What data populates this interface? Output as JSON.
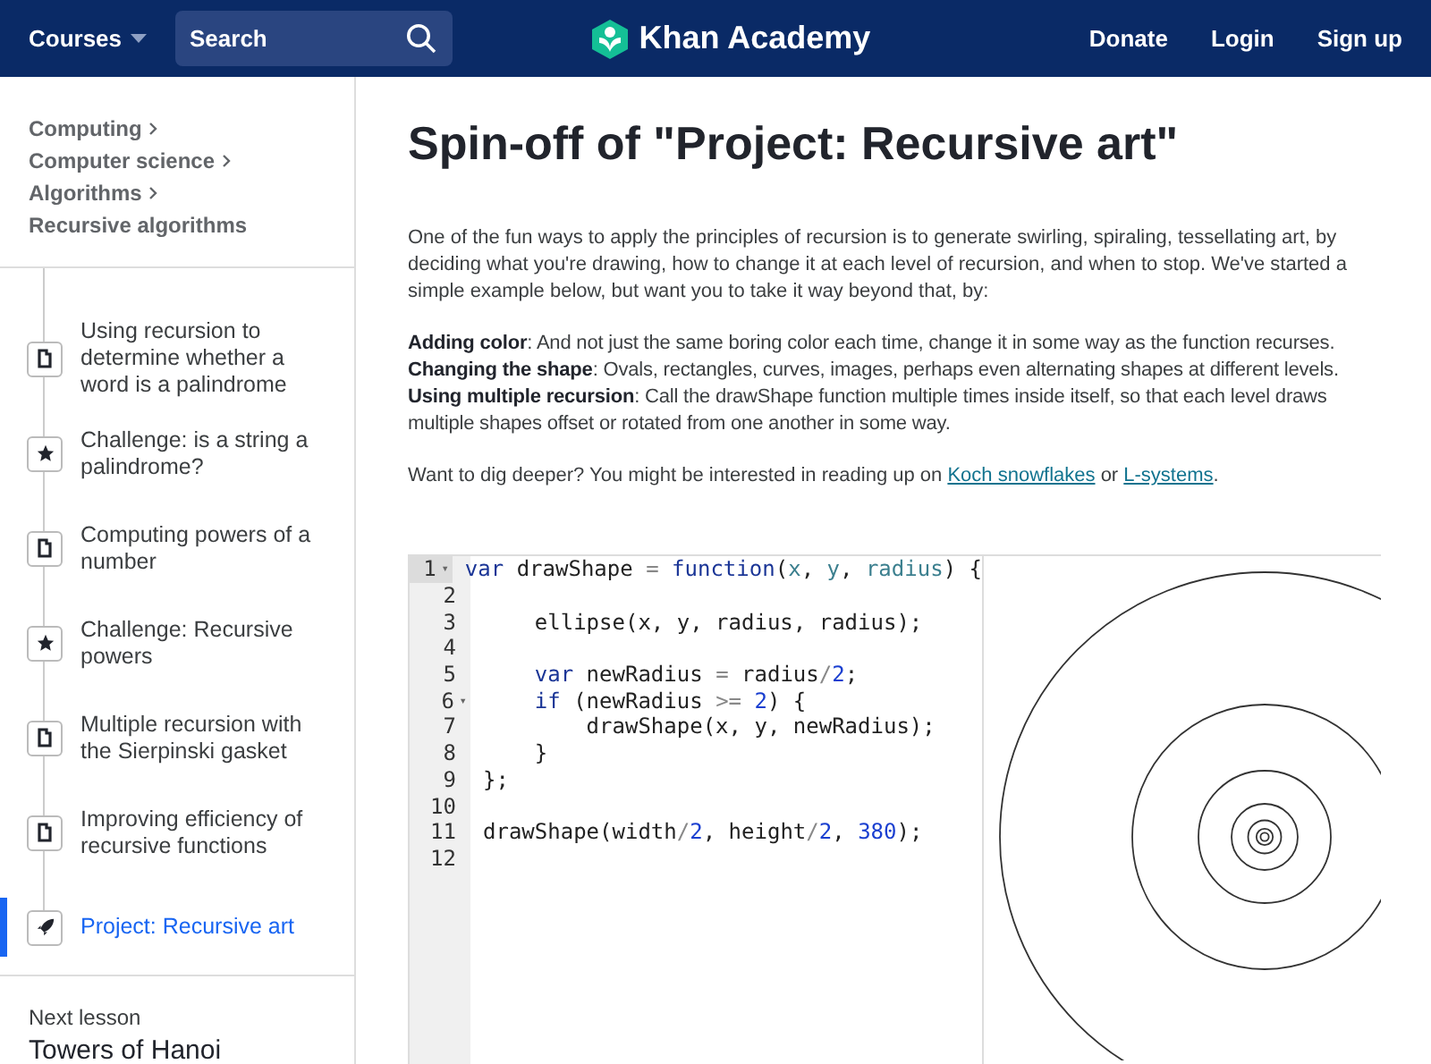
{
  "header": {
    "courses": "Courses",
    "search": {
      "placeholder": "Search"
    },
    "logo": "Khan Academy",
    "links": [
      "Donate",
      "Login",
      "Sign up"
    ]
  },
  "sidebar": {
    "breadcrumb": [
      "Computing",
      "Computer science",
      "Algorithms",
      "Recursive algorithms"
    ],
    "items": [
      {
        "kind": "article",
        "title": "Using recursion to determine whether a word is a palindrome",
        "selected": false
      },
      {
        "kind": "challenge",
        "title": "Challenge: is a string a palindrome?",
        "selected": false
      },
      {
        "kind": "article",
        "title": "Computing powers of a number",
        "selected": false
      },
      {
        "kind": "challenge",
        "title": "Challenge: Recursive powers",
        "selected": false
      },
      {
        "kind": "article",
        "title": "Multiple recursion with the Sierpinski gasket",
        "selected": false
      },
      {
        "kind": "article",
        "title": "Improving efficiency of recursive functions",
        "selected": false
      },
      {
        "kind": "project",
        "title": "Project: Recursive art",
        "selected": true
      }
    ],
    "next": {
      "label": "Next lesson",
      "title": "Towers of Hanoi"
    }
  },
  "main": {
    "title": "Spin-off of \"Project: Recursive art\"",
    "intro": "One of the fun ways to apply the principles of recursion is to generate swirling, spiraling, tessellating art, by deciding what you're drawing, how to change it at each level of recursion, and when to stop. We've started a simple example below, but want you to take it way beyond that, by:",
    "tips": [
      "**Adding color**: And not just the same boring color each time, change it in some way as the function recurses.",
      "**Changing the shape**: Ovals, rectangles, curves, images, perhaps even alternating shapes at different levels.",
      "**Using multiple recursion**: Call the drawShape function multiple times inside itself, so that each level draws multiple shapes offset or rotated from one another in some way."
    ],
    "deeper": {
      "text": "Want to dig deeper? You might be interested in reading up on",
      "link1": "Koch snowflakes",
      "or": "or",
      "link2": "L-systems",
      "end": "."
    }
  },
  "editor": {
    "lines": [
      {
        "number": "1",
        "fold_marker": "▾",
        "active": true,
        "tokens": [
          {
            "kind": "kw",
            "text": "var"
          },
          {
            "kind": "id",
            "text": " drawShape "
          },
          {
            "kind": "op",
            "text": "="
          },
          {
            "kind": "kw",
            "text": " function"
          },
          {
            "kind": "id",
            "text": "("
          },
          {
            "kind": "param",
            "text": "x"
          },
          {
            "kind": "id",
            "text": ", "
          },
          {
            "kind": "param",
            "text": "y"
          },
          {
            "kind": "id",
            "text": ", "
          },
          {
            "kind": "param",
            "text": "radius"
          },
          {
            "kind": "id",
            "text": ") {"
          }
        ]
      },
      {
        "number": "2",
        "active": false
      },
      {
        "number": "3",
        "active": false,
        "tokens": [
          {
            "kind": "id",
            "text": "    ellipse(x, y, radius, radius);"
          }
        ]
      },
      {
        "number": "4",
        "active": false
      },
      {
        "number": "5",
        "active": false,
        "tokens": [
          {
            "kind": "kw",
            "text": "    var"
          },
          {
            "kind": "id",
            "text": " newRadius "
          },
          {
            "kind": "op",
            "text": "="
          },
          {
            "kind": "id",
            "text": " radius"
          },
          {
            "kind": "op",
            "text": "/"
          },
          {
            "kind": "num",
            "text": "2"
          },
          {
            "kind": "id",
            "text": ";"
          }
        ]
      },
      {
        "number": "6",
        "fold_marker": "▾",
        "active": false,
        "tokens": [
          {
            "kind": "kw",
            "text": "    if"
          },
          {
            "kind": "id",
            "text": " (newRadius "
          },
          {
            "kind": "op",
            "text": ">="
          },
          {
            "kind": "num",
            "text": " 2"
          },
          {
            "kind": "id",
            "text": ") {"
          }
        ]
      },
      {
        "number": "7",
        "active": false,
        "tokens": [
          {
            "kind": "id",
            "text": "        drawShape(x, y, newRadius);"
          }
        ]
      },
      {
        "number": "8",
        "active": false,
        "tokens": [
          {
            "kind": "id",
            "text": "    }"
          }
        ]
      },
      {
        "number": "9",
        "active": false,
        "tokens": [
          {
            "kind": "id",
            "text": "};"
          }
        ]
      },
      {
        "number": "10",
        "active": false
      },
      {
        "number": "11",
        "active": false,
        "tokens": [
          {
            "kind": "id",
            "text": "drawShape(width"
          },
          {
            "kind": "op",
            "text": "/"
          },
          {
            "kind": "num",
            "text": "2"
          },
          {
            "kind": "id",
            "text": ", height"
          },
          {
            "kind": "op",
            "text": "/"
          },
          {
            "kind": "num",
            "text": "2"
          },
          {
            "kind": "id",
            "text": ", "
          },
          {
            "kind": "num",
            "text": "380"
          },
          {
            "kind": "id",
            "text": ");"
          }
        ]
      },
      {
        "number": "12",
        "active": false
      }
    ]
  }
}
